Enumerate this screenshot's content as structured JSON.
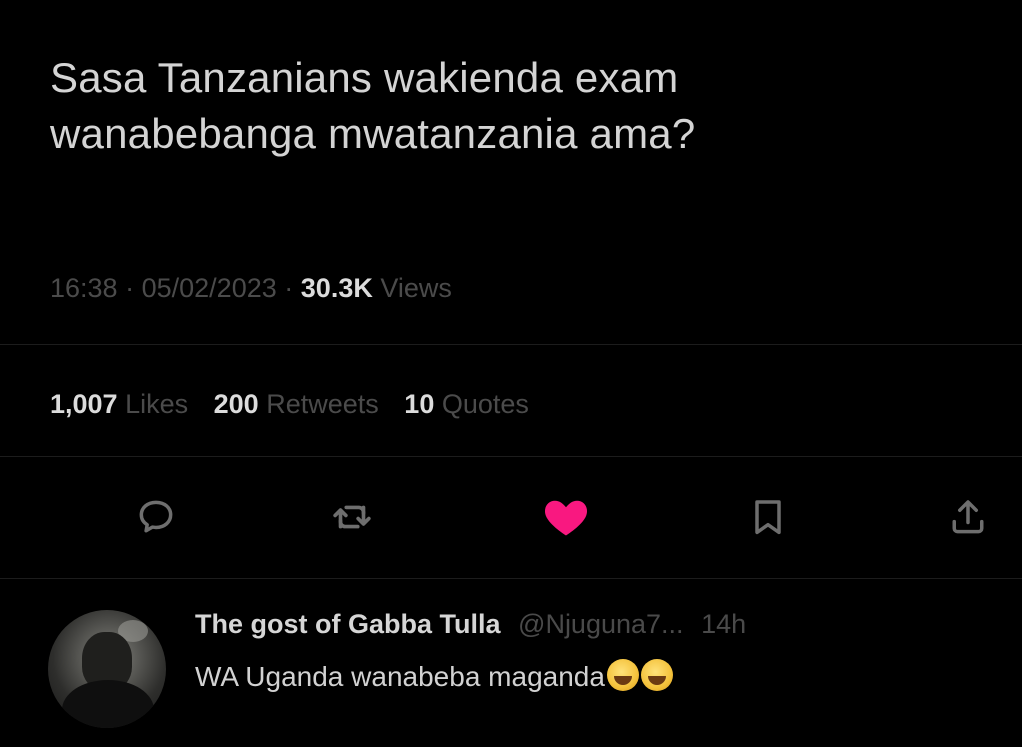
{
  "tweet": {
    "text_line1": "Sasa Tanzanians wakienda exam",
    "text_line2": "wanabebanga mwatanzania ama?",
    "time": "16:38",
    "separator": "·",
    "date": "05/02/2023",
    "views_count": "30.3K",
    "views_label": "Views"
  },
  "stats": {
    "likes_count": "1,007",
    "likes_label": "Likes",
    "retweets_count": "200",
    "retweets_label": "Retweets",
    "quotes_count": "10",
    "quotes_label": "Quotes"
  },
  "actions": {
    "reply_icon": "reply-icon",
    "retweet_icon": "retweet-icon",
    "like_icon": "heart-icon",
    "bookmark_icon": "bookmark-icon",
    "share_icon": "share-icon",
    "like_color": "#f91880",
    "icon_color": "#6e6e6e"
  },
  "reply": {
    "name": "The gost of Gabba Tulla",
    "handle": "@Njuguna7...",
    "time": "14h",
    "text": "WA Uganda wanabeba maganda"
  }
}
